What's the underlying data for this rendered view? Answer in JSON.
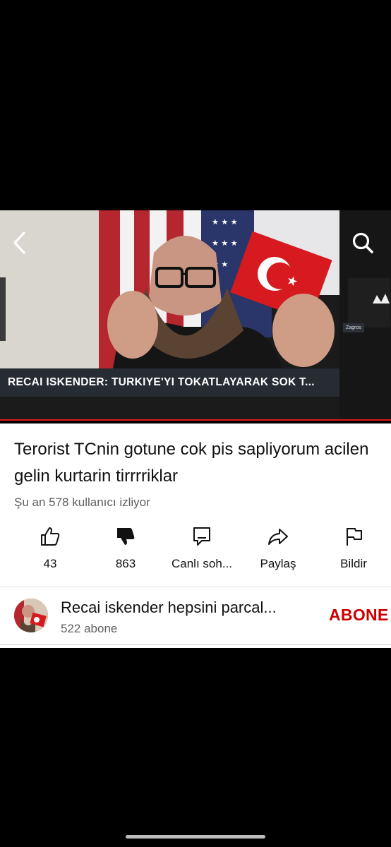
{
  "video": {
    "caption": "RECAI ISKENDER: TURKIYE'YI TOKATLAYARAK SOK T...",
    "pip_label": "Zagros",
    "back_icon": "chevron-left-icon",
    "search_icon": "search-icon",
    "accent_color": "#e01919"
  },
  "details": {
    "title": "Terorist TCnin gotune cok pis sapliyorum acilen gelin kurtarin tirrrriklar",
    "viewers": "Şu an 578 kullanıcı izliyor"
  },
  "actions": [
    {
      "icon": "thumbs-up-icon",
      "label": "43"
    },
    {
      "icon": "thumbs-down-icon",
      "label": "863"
    },
    {
      "icon": "chat-icon",
      "label": "Canlı soh..."
    },
    {
      "icon": "share-icon",
      "label": "Paylaş"
    },
    {
      "icon": "flag-icon",
      "label": "Bildir"
    }
  ],
  "channel": {
    "name": "Recai iskender hepsini parcal...",
    "subscribers": "522 abone",
    "subscribe_label": "ABONE",
    "subscribe_color": "#cc0000"
  }
}
